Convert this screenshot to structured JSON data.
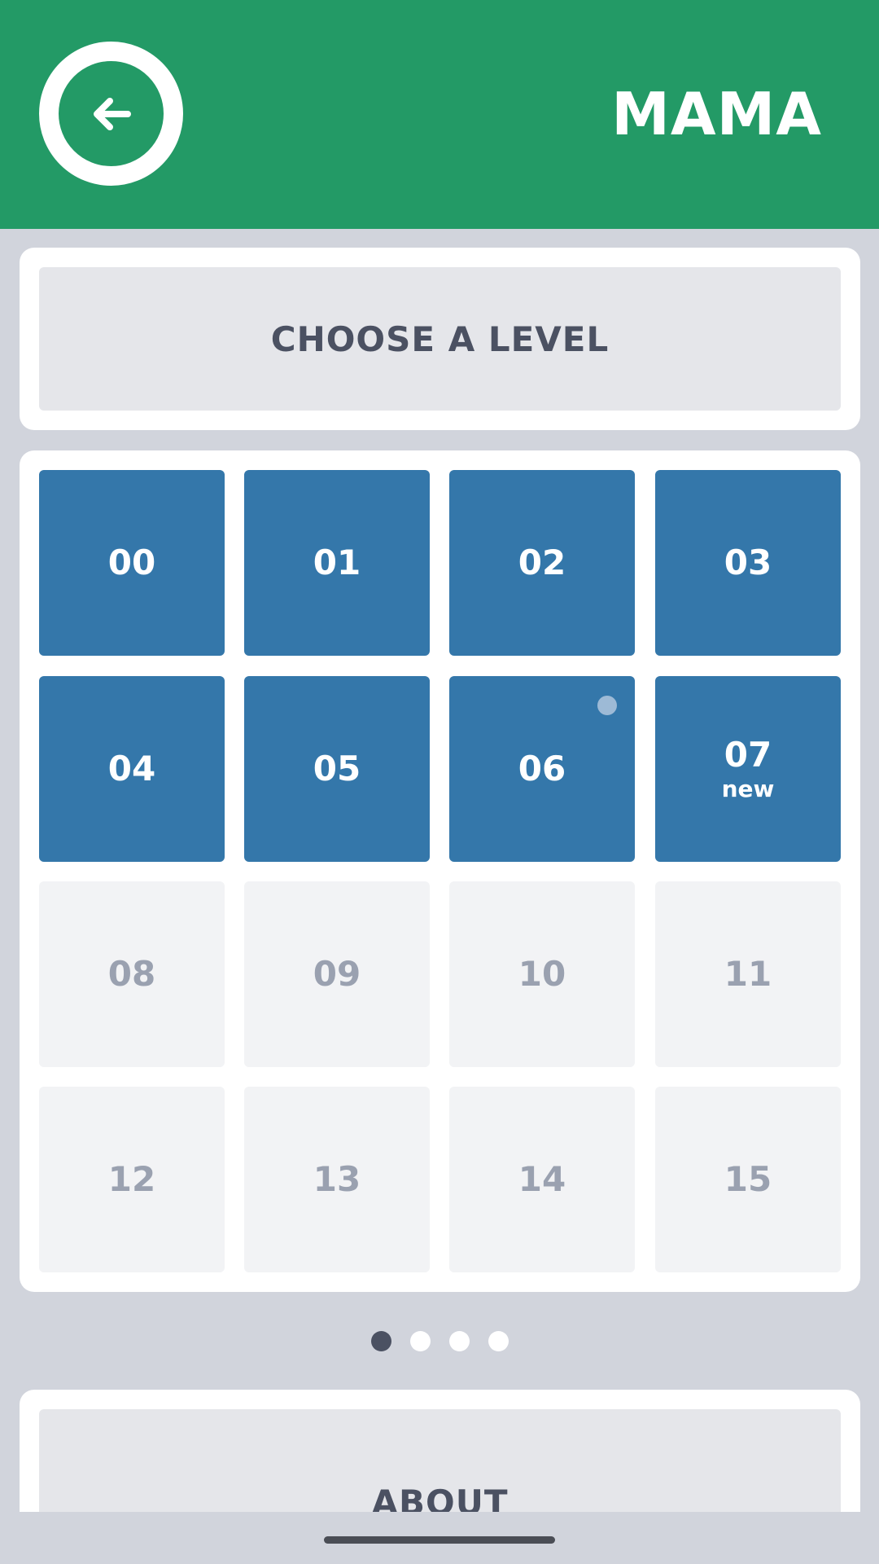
{
  "header": {
    "title": "MAMA",
    "back_icon": "arrow-left-icon",
    "background": "#239a66"
  },
  "level_select": {
    "title": "CHOOSE A LEVEL"
  },
  "levels": [
    {
      "label": "00",
      "unlocked": true,
      "badge": "",
      "dot": false
    },
    {
      "label": "01",
      "unlocked": true,
      "badge": "",
      "dot": false
    },
    {
      "label": "02",
      "unlocked": true,
      "badge": "",
      "dot": false
    },
    {
      "label": "03",
      "unlocked": true,
      "badge": "",
      "dot": false
    },
    {
      "label": "04",
      "unlocked": true,
      "badge": "",
      "dot": false
    },
    {
      "label": "05",
      "unlocked": true,
      "badge": "",
      "dot": false
    },
    {
      "label": "06",
      "unlocked": true,
      "badge": "",
      "dot": true
    },
    {
      "label": "07",
      "unlocked": true,
      "badge": "new",
      "dot": false
    },
    {
      "label": "08",
      "unlocked": false,
      "badge": "",
      "dot": false
    },
    {
      "label": "09",
      "unlocked": false,
      "badge": "",
      "dot": false
    },
    {
      "label": "10",
      "unlocked": false,
      "badge": "",
      "dot": false
    },
    {
      "label": "11",
      "unlocked": false,
      "badge": "",
      "dot": false
    },
    {
      "label": "12",
      "unlocked": false,
      "badge": "",
      "dot": false
    },
    {
      "label": "13",
      "unlocked": false,
      "badge": "",
      "dot": false
    },
    {
      "label": "14",
      "unlocked": false,
      "badge": "",
      "dot": false
    },
    {
      "label": "15",
      "unlocked": false,
      "badge": "",
      "dot": false
    }
  ],
  "pager": {
    "page_count": 4,
    "current_page": 1
  },
  "about": {
    "title": "ABOUT"
  },
  "colors": {
    "unlocked_tile": "#3477aa",
    "locked_tile": "#f2f3f5",
    "text_dark": "#4b5162"
  }
}
